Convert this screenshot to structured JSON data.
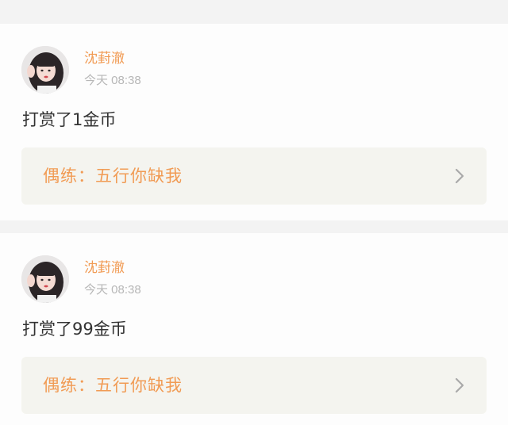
{
  "posts": [
    {
      "username": "沈葑澈",
      "timestamp": "今天 08:38",
      "message": "打赏了1金币",
      "link_text": "偶练：五行你缺我",
      "avatar_icon": "avatar-photo",
      "chevron_icon": "chevron-right-icon"
    },
    {
      "username": "沈葑澈",
      "timestamp": "今天 08:38",
      "message": "打赏了99金币",
      "link_text": "偶练：五行你缺我",
      "avatar_icon": "avatar-photo",
      "chevron_icon": "chevron-right-icon"
    }
  ],
  "colors": {
    "page_background": "#f3f3f3",
    "card_background": "#fdfdfd",
    "accent": "#f19b54",
    "muted": "#b7b7b7",
    "text": "#333333",
    "panel_background": "#f4f4ef"
  }
}
